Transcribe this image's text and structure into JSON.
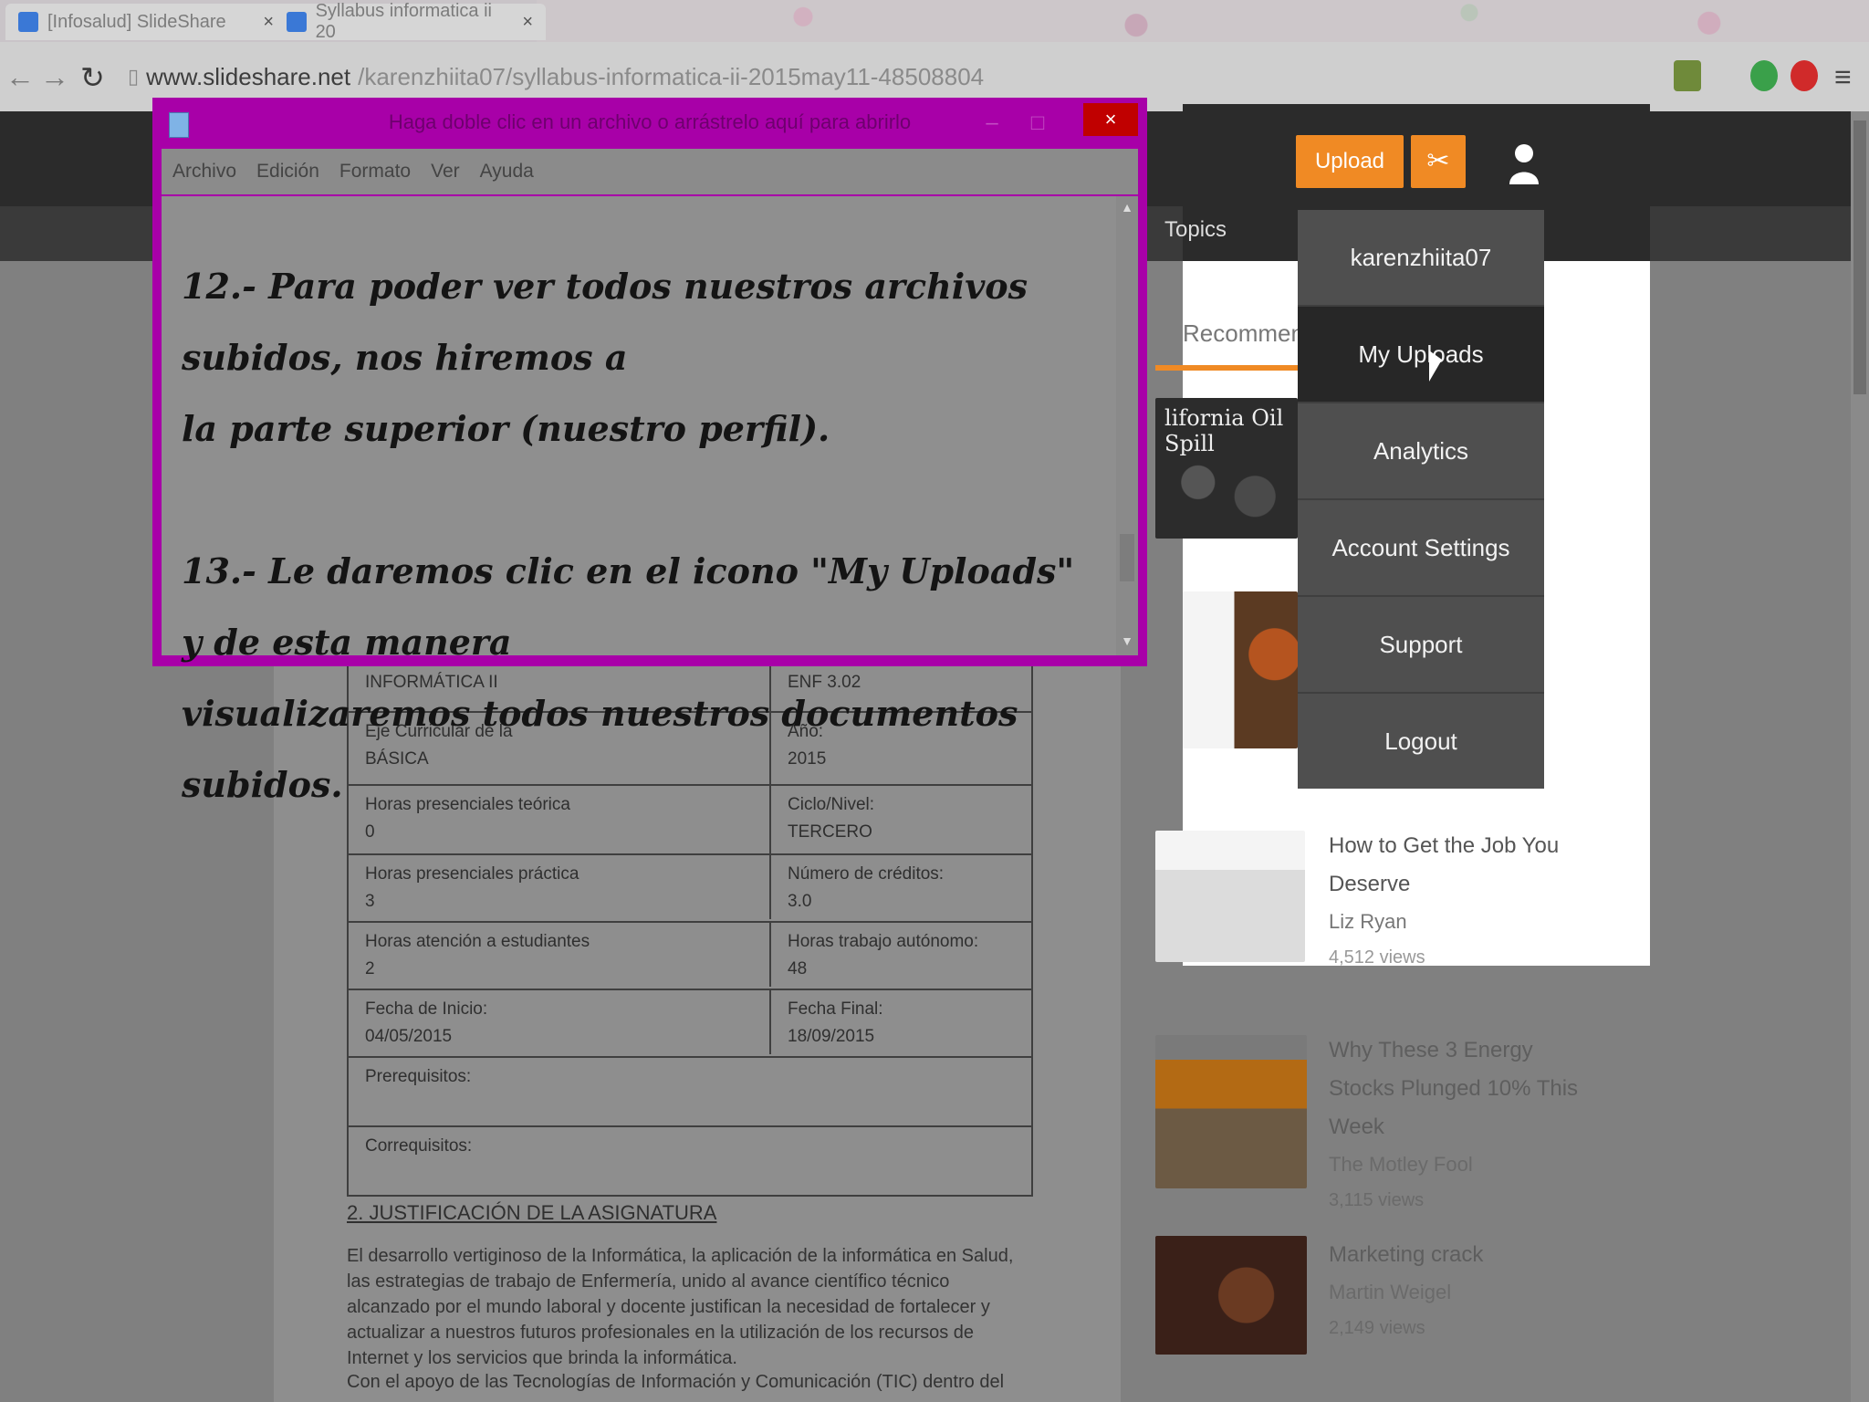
{
  "browser": {
    "tabs": [
      {
        "label": "[Infosalud] SlideShare"
      },
      {
        "label": "Syllabus informatica ii 20"
      }
    ],
    "url": {
      "host": "www.slideshare.net",
      "path": "/karenzhiita07/syllabus-informatica-ii-2015may11-48508804"
    }
  },
  "notepad": {
    "title": "Haga doble clic en un archivo o arrástrelo aquí para abrirlo",
    "menu": [
      "Archivo",
      "Edición",
      "Formato",
      "Ver",
      "Ayuda"
    ],
    "close_label": "×",
    "body_text": "12.- Para poder ver todos nuestros archivos subidos, nos hiremos a\nla parte superior (nuestro perfil).\n\n13.- Le daremos clic en el icono \"My Uploads\" y de esta manera\nvisualizaremos todos nuestros documentos subidos."
  },
  "site": {
    "upload_label": "Upload",
    "topics_label": "Topics",
    "recommended_label": "Recommended",
    "user_menu": {
      "username": "karenzhiita07",
      "items": [
        "My Uploads",
        "Analytics",
        "Account Settings",
        "Support",
        "Logout"
      ],
      "active": "My Uploads"
    },
    "recommended": [
      {
        "title": "How to Get the Job You Deserve",
        "author": "Liz Ryan",
        "views": "4,512 views"
      },
      {
        "title": "Why These 3 Energy Stocks Plunged 10% This Week",
        "author": "The Motley Fool",
        "views": "3,115 views"
      },
      {
        "title": "Marketing crack",
        "author": "Martin Weigel",
        "views": "2,149 views"
      }
    ],
    "thumb_label": "lifornia Oil Spill"
  },
  "document": {
    "table": [
      {
        "left": "INFORMÁTICA II",
        "right": "ENF 3.02"
      },
      {
        "left": "Eje Curricular de la\nBÁSICA",
        "right": "Año:\n2015"
      },
      {
        "left": "Horas presenciales teórica\n0",
        "right": "Ciclo/Nivel:\nTERCERO"
      },
      {
        "left": "Horas presenciales práctica\n3",
        "right": "Número de créditos:\n3.0"
      },
      {
        "left": "Horas atención a estudiantes\n2",
        "right": "Horas trabajo autónomo:\n48"
      },
      {
        "left": "Fecha de Inicio:\n04/05/2015",
        "right": "Fecha Final:\n18/09/2015"
      },
      {
        "full": "Prerequisitos:"
      },
      {
        "full": "Correquisitos:"
      }
    ],
    "heading": "2. JUSTIFICACIÓN DE LA ASIGNATURA",
    "para1": "El desarrollo vertiginoso de la Informática, la aplicación de la informática en Salud, las estrategias de trabajo de Enfermería, unido al avance científico técnico alcanzado por el mundo laboral y docente justifican la necesidad de fortalecer y actualizar a nuestros futuros profesionales en la utilización de los recursos de Internet y los servicios que brinda la informática.",
    "para2": "Con el apoyo de las Tecnologías de Información y Comunicación (TIC) dentro del campo"
  }
}
